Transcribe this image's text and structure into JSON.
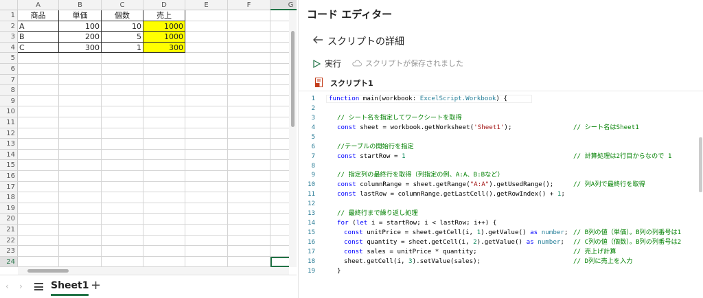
{
  "spreadsheet": {
    "columns": [
      "A",
      "B",
      "C",
      "D",
      "E",
      "F",
      "G"
    ],
    "rows": [
      "1",
      "2",
      "3",
      "4",
      "5",
      "6",
      "7",
      "8",
      "9",
      "10",
      "11",
      "12",
      "13",
      "14",
      "15",
      "16",
      "17",
      "18",
      "19",
      "20",
      "21",
      "22",
      "23",
      "24"
    ],
    "table": {
      "header": [
        "商品",
        "単価",
        "個数",
        "売上"
      ],
      "data": [
        [
          "A",
          "100",
          "10",
          "1000"
        ],
        [
          "B",
          "200",
          "5",
          "1000"
        ],
        [
          "C",
          "300",
          "1",
          "300"
        ]
      ]
    },
    "highlight_color": "#ffff00",
    "sheet_tab": "Sheet1",
    "add_sheet": "+"
  },
  "editor": {
    "title": "コード エディター",
    "back_label": "スクリプトの詳細",
    "run_label": "実行",
    "save_status": "スクリプトが保存されました",
    "script_name": "スクリプト1",
    "line_numbers": [
      "1",
      "2",
      "3",
      "4",
      "5",
      "6",
      "7",
      "8",
      "9",
      "10",
      "11",
      "12",
      "13",
      "14",
      "15",
      "16",
      "17",
      "18",
      "19"
    ],
    "lines": {
      "l1": {
        "kw": "function",
        "rest": " main(workbook: ",
        "ty": "ExcelScript.Workbook",
        "end": ") {"
      },
      "l3": "// シート名を指定してワークシートを取得",
      "l4": {
        "kw": "const",
        "a": " sheet = workbook.getWorksheet(",
        "st": "'Sheet1'",
        "b": ");",
        "cm": "// シート名はSheet1"
      },
      "l6": "//テーブルの開始行を指定",
      "l7": {
        "kw": "const",
        "a": " startRow = ",
        "nm": "1",
        "cm": "// 計算処理は2行目からなので 1"
      },
      "l9": "// 指定列の最終行を取得（列指定の例、A:A、B:Bなど）",
      "l10": {
        "kw": "const",
        "a": " columnRange = sheet.getRange(",
        "st": "\"A:A\"",
        "b": ").getUsedRange();",
        "cm": "// 列A列で最終行を取得"
      },
      "l11": {
        "kw": "const",
        "a": " lastRow = columnRange.getLastCell().getRowIndex() + ",
        "nm": "1",
        "b": ";"
      },
      "l13": "// 最終行まで繰り返し処理",
      "l14": {
        "kw": "for",
        "a": " (",
        "kw2": "let",
        "b": " i = startRow; i < lastRow; i++) {"
      },
      "l15": {
        "kw": "const",
        "a": " unitPrice = sheet.getCell(i, ",
        "nm": "1",
        "b": ").getValue() ",
        "kw2": "as",
        "ty": "number",
        "c": ";",
        "cm": "// B列の値（単価）。B列の列番号は1"
      },
      "l16": {
        "kw": "const",
        "a": " quantity = sheet.getCell(i, ",
        "nm": "2",
        "b": ").getValue() ",
        "kw2": "as",
        "ty": "number",
        "c": ";",
        "cm": "// C列の値（個数）。B列の列番号は2"
      },
      "l17": {
        "kw": "const",
        "a": " sales = unitPrice * quantity;",
        "cm": "// 売上げ計算"
      },
      "l18": {
        "a": "sheet.getCell(i, ",
        "nm": "3",
        "b": ").setValue(sales);",
        "cm": "// D列に売上を入力"
      },
      "l19": "}"
    }
  }
}
